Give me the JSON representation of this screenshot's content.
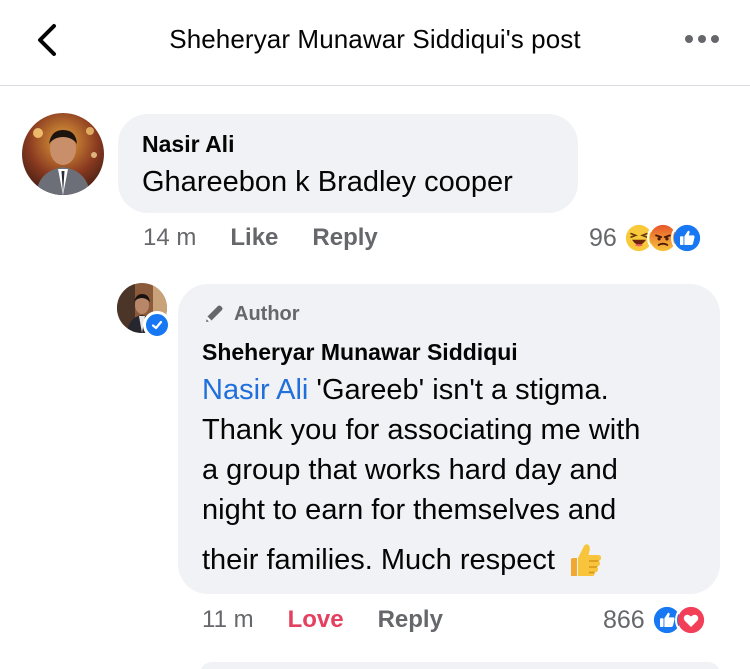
{
  "header": {
    "title": "Sheheryar Munawar Siddiqui's post",
    "back_icon": "chevron-left-icon",
    "more_icon": "more-horizontal-icon"
  },
  "comments": [
    {
      "author": "Nasir Ali",
      "text": "Ghareebon k Bradley cooper",
      "time": "14 m",
      "actions": [
        "Like",
        "Reply"
      ],
      "reaction_count": "96",
      "reactions": [
        "haha-icon",
        "angry-icon",
        "like-icon"
      ]
    }
  ],
  "reply": {
    "badge": "Author",
    "author": "Sheheryar Munawar Siddiqui",
    "mention": "Nasir Ali",
    "lines": [
      " 'Gareeb' isn't a stigma.",
      "Thank you for associating me with",
      "a group that works hard day and",
      "night to earn for themselves and",
      "their families. Much respect"
    ],
    "emoji": "thumbs-up-emoji",
    "time": "11 m",
    "actions": [
      "Love",
      "Reply"
    ],
    "reaction_count": "866",
    "reactions": [
      "like-icon",
      "love-icon"
    ]
  },
  "colors": {
    "link_blue": "#216fdb",
    "love_red": "#e4405f",
    "meta_gray": "#65676b",
    "bubble_bg": "#f0f2f5",
    "fb_blue": "#1877f2"
  }
}
